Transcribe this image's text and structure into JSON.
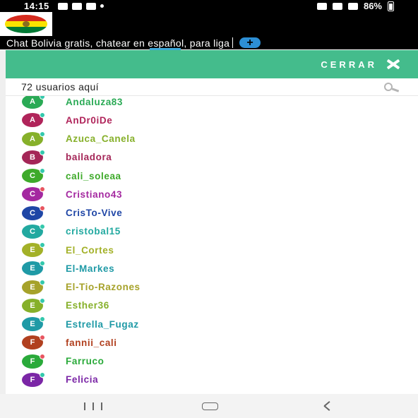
{
  "status_bar": {
    "time": "14:15",
    "battery": "86%",
    "icons": [
      "photo-icon",
      "youtube-icon",
      "whatsapp-icon",
      "dot-icon",
      "mute-icon",
      "wifi-icon",
      "signal-icon",
      "battery-icon"
    ]
  },
  "app": {
    "ticker_text": "Chat Bolivia gratis, chatear en español, para liga",
    "plus_label": "+",
    "flag_colors": [
      "#d52b1e",
      "#f9e300",
      "#007934"
    ]
  },
  "panel": {
    "close_label": "CERRAR",
    "accent_color": "#44bc8c",
    "user_count_text": "72 usuarios aquí"
  },
  "users": [
    {
      "name": "Andaluza83",
      "initial": "A",
      "avatar_color": "#2aaa55",
      "name_color": "#2aaa55",
      "dot_color": "#33c8ac"
    },
    {
      "name": "AnDr0iDe",
      "initial": "A",
      "avatar_color": "#b0245a",
      "name_color": "#b0245a",
      "dot_color": "#33c8ac"
    },
    {
      "name": "Azuca_Canela",
      "initial": "A",
      "avatar_color": "#86b02a",
      "name_color": "#86b02a",
      "dot_color": "#33c8ac"
    },
    {
      "name": "bailadora",
      "initial": "B",
      "avatar_color": "#a42657",
      "name_color": "#a42657",
      "dot_color": "#33c8ac"
    },
    {
      "name": "cali_soleaa",
      "initial": "C",
      "avatar_color": "#3eaa2a",
      "name_color": "#3eaa2a",
      "dot_color": "#33c8ac"
    },
    {
      "name": "Cristiano43",
      "initial": "C",
      "avatar_color": "#a428a0",
      "name_color": "#a428a0",
      "dot_color": "#e85560"
    },
    {
      "name": "CrisTo-Vive",
      "initial": "C",
      "avatar_color": "#1f46a6",
      "name_color": "#1f46a6",
      "dot_color": "#e85560"
    },
    {
      "name": "cristobal15",
      "initial": "C",
      "avatar_color": "#22a9a0",
      "name_color": "#22a9a0",
      "dot_color": "#33c8ac"
    },
    {
      "name": "El_Cortes",
      "initial": "E",
      "avatar_color": "#a3b128",
      "name_color": "#a3b128",
      "dot_color": "#33c8ac"
    },
    {
      "name": "El-Markes",
      "initial": "E",
      "avatar_color": "#1f9aa6",
      "name_color": "#1f9aa6",
      "dot_color": "#33c8ac"
    },
    {
      "name": "El-Tio-Razones",
      "initial": "E",
      "avatar_color": "#a6a22a",
      "name_color": "#a6a22a",
      "dot_color": "#33c8ac"
    },
    {
      "name": "Esther36",
      "initial": "E",
      "avatar_color": "#86b02a",
      "name_color": "#86b02a",
      "dot_color": "#33c8ac"
    },
    {
      "name": "Estrella_Fugaz",
      "initial": "E",
      "avatar_color": "#1f9aa6",
      "name_color": "#1f9aa6",
      "dot_color": "#33c8ac"
    },
    {
      "name": "fannii_cali",
      "initial": "F",
      "avatar_color": "#b1401f",
      "name_color": "#b1401f",
      "dot_color": "#e85560"
    },
    {
      "name": "Farruco",
      "initial": "F",
      "avatar_color": "#2aaa3a",
      "name_color": "#2aaa3a",
      "dot_color": "#e85560"
    },
    {
      "name": "Felicia",
      "initial": "F",
      "avatar_color": "#7b26a6",
      "name_color": "#7b26a6",
      "dot_color": "#33c8ac"
    }
  ]
}
